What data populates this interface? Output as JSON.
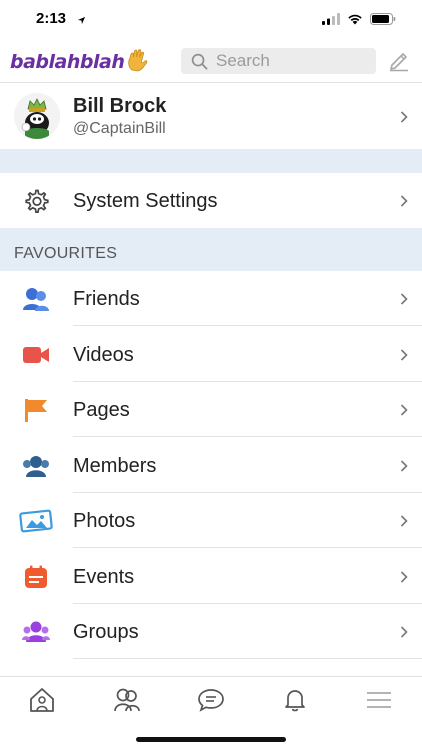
{
  "status": {
    "time": "2:13"
  },
  "header": {
    "logo_text": "bablahblah",
    "search_placeholder": "Search"
  },
  "profile": {
    "name": "Bill Brock",
    "handle": "@CaptainBill"
  },
  "settings": {
    "label": "System Settings"
  },
  "favourites": {
    "title": "FAVOURITES",
    "items": [
      {
        "label": "Friends",
        "icon": "friends-icon",
        "color": "#3b6fd6"
      },
      {
        "label": "Videos",
        "icon": "video-camera-icon",
        "color": "#e8544a"
      },
      {
        "label": "Pages",
        "icon": "flag-icon",
        "color": "#f08a2c"
      },
      {
        "label": "Members",
        "icon": "members-icon",
        "color": "#2f5f8f"
      },
      {
        "label": "Photos",
        "icon": "photos-icon",
        "color": "#3a9be0"
      },
      {
        "label": "Events",
        "icon": "calendar-icon",
        "color": "#ef5a2f"
      },
      {
        "label": "Groups",
        "icon": "groups-icon",
        "color": "#9b3fe0"
      }
    ]
  },
  "tabbar": [
    "home-icon",
    "friends-tab-icon",
    "chat-icon",
    "bell-icon",
    "menu-icon"
  ]
}
